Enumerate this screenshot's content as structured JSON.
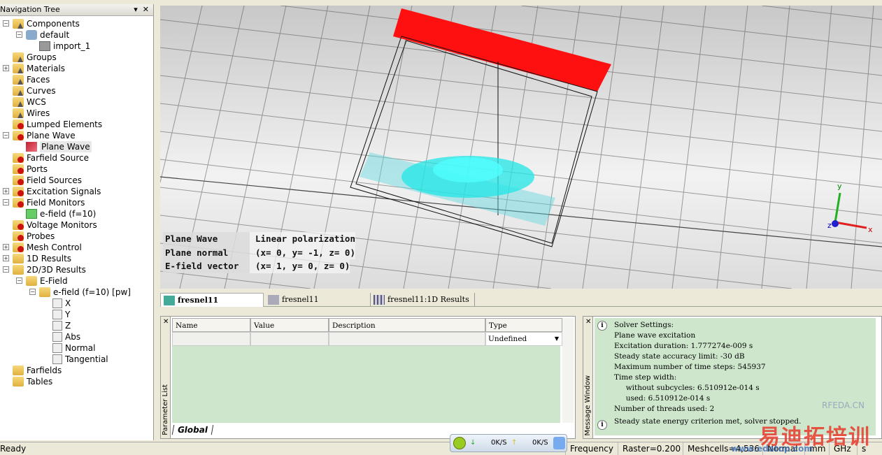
{
  "nav": {
    "title": "Navigation Tree",
    "pin": "▾",
    "close": "✕",
    "items": [
      {
        "label": "Components",
        "level": 0,
        "toggle": "-",
        "icon": "gray"
      },
      {
        "label": "default",
        "level": 1,
        "toggle": "-",
        "icon": "comp"
      },
      {
        "label": "import_1",
        "level": 2,
        "icon": "cube"
      },
      {
        "label": "Groups",
        "level": 0,
        "icon": "gray"
      },
      {
        "label": "Materials",
        "level": 0,
        "toggle": "+",
        "icon": "gray"
      },
      {
        "label": "Faces",
        "level": 0,
        "icon": "gray"
      },
      {
        "label": "Curves",
        "level": 0,
        "icon": "gray"
      },
      {
        "label": "WCS",
        "level": 0,
        "icon": "gray"
      },
      {
        "label": "Wires",
        "level": 0,
        "icon": "gray"
      },
      {
        "label": "Lumped Elements",
        "level": 0,
        "icon": "red"
      },
      {
        "label": "Plane Wave",
        "level": 0,
        "toggle": "-",
        "icon": "red"
      },
      {
        "label": "Plane Wave",
        "level": 1,
        "icon": "pw",
        "selected": true
      },
      {
        "label": "Farfield Source",
        "level": 0,
        "icon": "red"
      },
      {
        "label": "Ports",
        "level": 0,
        "icon": "red"
      },
      {
        "label": "Field Sources",
        "level": 0,
        "icon": "red"
      },
      {
        "label": "Excitation Signals",
        "level": 0,
        "toggle": "+",
        "icon": "red"
      },
      {
        "label": "Field Monitors",
        "level": 0,
        "toggle": "-",
        "icon": "red"
      },
      {
        "label": "e-field (f=10)",
        "level": 1,
        "icon": "mon"
      },
      {
        "label": "Voltage Monitors",
        "level": 0,
        "icon": "red"
      },
      {
        "label": "Probes",
        "level": 0,
        "icon": "red"
      },
      {
        "label": "Mesh Control",
        "level": 0,
        "toggle": "+",
        "icon": "red"
      },
      {
        "label": "1D Results",
        "level": 0,
        "toggle": "+",
        "icon": "plain"
      },
      {
        "label": "2D/3D Results",
        "level": 0,
        "toggle": "-",
        "icon": "plain"
      },
      {
        "label": "E-Field",
        "level": 1,
        "toggle": "-",
        "icon": "plain"
      },
      {
        "label": "e-field (f=10) [pw]",
        "level": 2,
        "toggle": "-",
        "icon": "plain"
      },
      {
        "label": "X",
        "level": 3,
        "icon": "res"
      },
      {
        "label": "Y",
        "level": 3,
        "icon": "res"
      },
      {
        "label": "Z",
        "level": 3,
        "icon": "res"
      },
      {
        "label": "Abs",
        "level": 3,
        "icon": "res"
      },
      {
        "label": "Normal",
        "level": 3,
        "icon": "res"
      },
      {
        "label": "Tangential",
        "level": 3,
        "icon": "res"
      },
      {
        "label": "Farfields",
        "level": 0,
        "icon": "plain"
      },
      {
        "label": "Tables",
        "level": 0,
        "icon": "plain"
      }
    ]
  },
  "viewport": {
    "overlay": [
      {
        "key": "Plane Wave",
        "value": "Linear polarization"
      },
      {
        "key": "Plane normal",
        "value": "(x= 0, y= -1, z= 0)"
      },
      {
        "key": "E-field vector",
        "value": "(x= 1, y= 0, z= 0)"
      }
    ],
    "axes": {
      "x": "x",
      "y": "y",
      "z": "z"
    },
    "colors": {
      "plane": "#ff1010",
      "lens": "#20e0e0",
      "axis_x": "#e02020",
      "axis_y": "#20b020",
      "axis_z": "#2020d0"
    }
  },
  "tabs": [
    {
      "label": "fresnel11"
    },
    {
      "label": "fresnel11"
    },
    {
      "label": "fresnel11:1D Results"
    }
  ],
  "params": {
    "panel_title": "Parameter List",
    "columns": [
      "Name",
      "Value",
      "Description",
      "Type"
    ],
    "type_value": "Undefined",
    "sheet_tab": "Global"
  },
  "messages": {
    "panel_title": "Message Window",
    "block1": [
      "Solver Settings:",
      "Plane wave excitation",
      "Excitation duration: 1.777274e-009 s",
      "Steady state accuracy limit: -30 dB",
      "Maximum number of time steps: 545937",
      "Time step width:",
      "     without subcycles: 6.510912e-014 s",
      "     used: 6.510912e-014 s",
      "Number of threads used: 2"
    ],
    "block2": "Steady state energy criterion met, solver stopped."
  },
  "status": {
    "left": "Ready",
    "frequency": "Frequency",
    "raster": "Raster=0.200",
    "meshcells": "Meshcells=4,536",
    "mode": "Normal",
    "length_unit": "mm",
    "freq_unit": "GHz",
    "time_unit": "s"
  },
  "netmeter": {
    "down": "0K/S",
    "up": "0K/S"
  },
  "watermark": {
    "brand": "易迪拓培训",
    "url": "www.edatop.com",
    "site": "RFEDA.CN"
  }
}
